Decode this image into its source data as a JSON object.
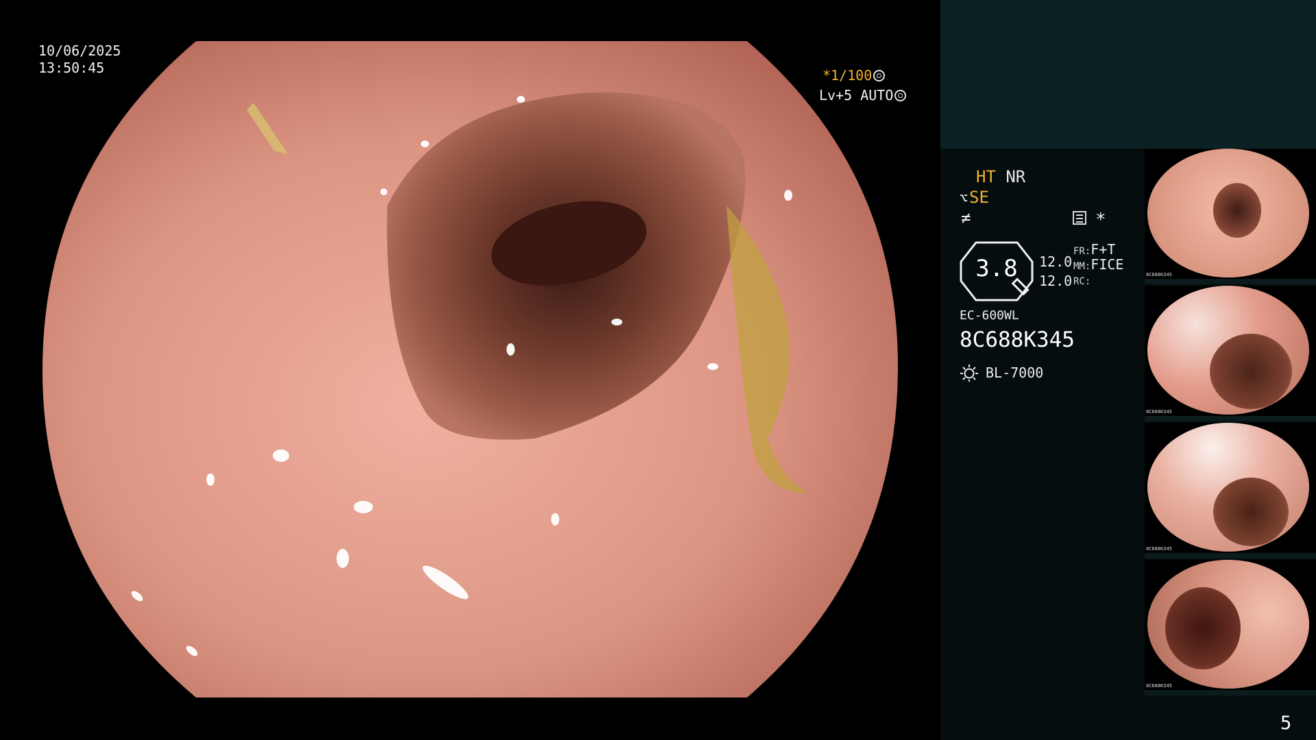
{
  "main_view": {
    "date": "10/06/2025",
    "time": "13:50:45",
    "shutter": "*1/100",
    "level": "Lv+5 AUTO"
  },
  "panel": {
    "ht_label": "HT",
    "nr_label": "NR",
    "se_label": "SE",
    "enhance_symbol": "≠",
    "star": "*",
    "octagon_value": "3.8",
    "value_1": "12.0",
    "value_2": "12.0",
    "fr_label": "FR:",
    "fr_value": "F+T",
    "mm_label": "MM:",
    "mm_value": "FICE",
    "rc_label": "RC:",
    "scope_model": "EC-600WL",
    "serial": "8C688K345",
    "light_source": "BL-7000"
  },
  "thumbnails": [
    {
      "index": "",
      "caption": "8C688K345"
    },
    {
      "index": "",
      "caption": "8C688K345"
    },
    {
      "index": "",
      "caption": "8C688K345"
    },
    {
      "index": "",
      "caption": "8C688K345"
    }
  ],
  "page_number": "5",
  "colors": {
    "accent": "#f0b030",
    "panel_top": "#0c2123",
    "panel_bottom": "#050d0e",
    "mucosa": "#d9907c"
  }
}
